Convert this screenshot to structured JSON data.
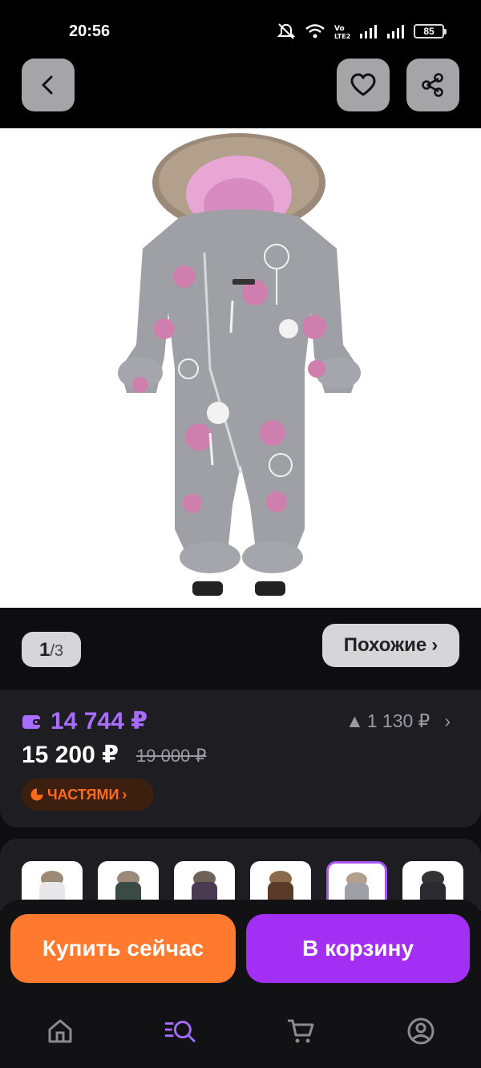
{
  "status_bar": {
    "time": "20:56",
    "battery": "85",
    "icons": [
      "mute-icon",
      "wifi-icon",
      "volte-icon",
      "signal-icon",
      "signal-icon",
      "battery-icon"
    ]
  },
  "toolbar": {
    "back_icon": "chevron-left-icon",
    "favorite_icon": "heart-icon",
    "share_icon": "share-icon"
  },
  "gallery": {
    "current": "1",
    "separator": "/",
    "total": "3",
    "similar_label": "Похожие",
    "similar_chevron": "›"
  },
  "price": {
    "wallet_price": "14 744 ₽",
    "delta_arrow": "▲",
    "delta": "1 130 ₽",
    "delta_chevron": "›",
    "current_price": "15 200 ₽",
    "old_price": "19 000 ₽",
    "installments_label": "ЧАСТЯМИ",
    "installments_chevron": "›"
  },
  "variants": {
    "selected_index": 4,
    "count": 6
  },
  "actions": {
    "buy_now": "Купить сейчас",
    "add_to_cart": "В корзину"
  },
  "colors": {
    "accent_purple": "#a76dff",
    "buy_orange": "#ff7a2e",
    "cart_purple": "#a32ef4",
    "installments_orange": "#ff6a1a"
  },
  "bottom_nav": {
    "items": [
      {
        "icon": "home-icon",
        "active": false
      },
      {
        "icon": "catalog-search-icon",
        "active": true
      },
      {
        "icon": "cart-icon",
        "active": false
      },
      {
        "icon": "profile-icon",
        "active": false
      }
    ]
  }
}
